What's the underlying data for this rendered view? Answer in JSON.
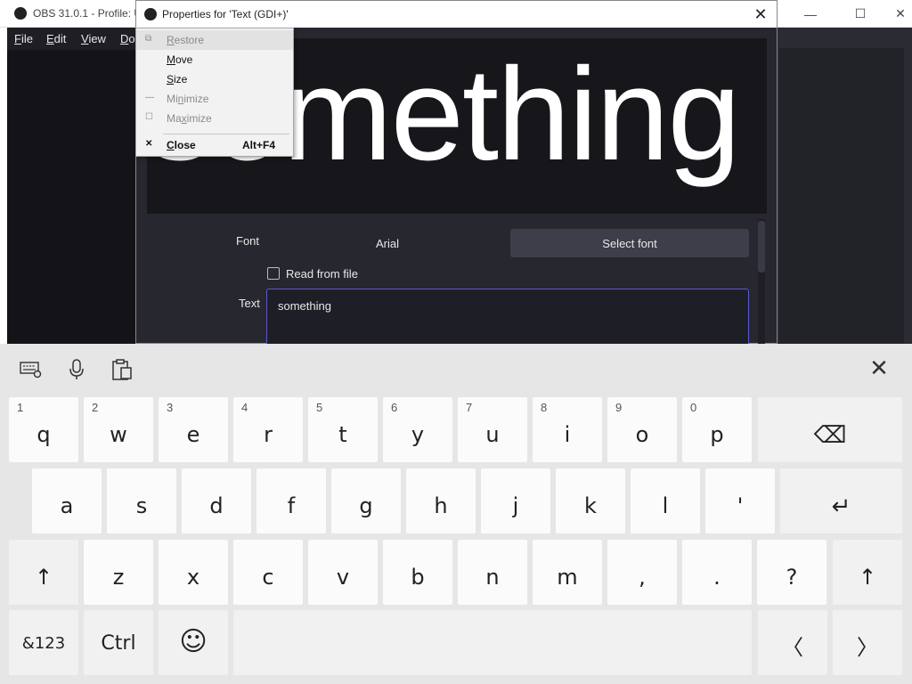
{
  "obs_window": {
    "title": "OBS 31.0.1 - Profile: U",
    "menu": [
      {
        "label": "File",
        "underline": "F",
        "rest": "ile"
      },
      {
        "label": "Edit",
        "underline": "E",
        "rest": "dit"
      },
      {
        "label": "View",
        "underline": "V",
        "rest": "iew"
      },
      {
        "label": "Do",
        "underline": "D",
        "rest": "o"
      }
    ],
    "minimize_glyph": "—",
    "maximize_glyph": "☐",
    "close_glyph": "✕"
  },
  "properties_dialog": {
    "title": "Properties for 'Text (GDI+)'",
    "close_glyph": "✕",
    "preview_text": "something",
    "font_label": "Font",
    "font_value": "Arial",
    "select_font_label": "Select font",
    "read_from_file_label": "Read from file",
    "read_from_file_checked": false,
    "text_label": "Text",
    "text_value": "something"
  },
  "system_menu": {
    "items": [
      {
        "label": "Restore",
        "u": "R",
        "rest": "estore",
        "icon": "restore-icon",
        "glyph": "⧉",
        "disabled": true
      },
      {
        "label": "Move",
        "u": "M",
        "rest": "ove",
        "icon": "",
        "glyph": "",
        "disabled": false
      },
      {
        "label": "Size",
        "u": "S",
        "rest": "ize",
        "icon": "",
        "glyph": "",
        "disabled": false
      },
      {
        "label": "Minimize",
        "u": "n",
        "pre": "Mi",
        "rest": "imize",
        "icon": "minimize-icon",
        "glyph": "—",
        "disabled": true
      },
      {
        "label": "Maximize",
        "u": "x",
        "pre": "Ma",
        "rest": "imize",
        "icon": "maximize-icon",
        "glyph": "☐",
        "disabled": true
      },
      {
        "label": "Close",
        "u": "C",
        "rest": "lose",
        "icon": "close-icon",
        "glyph": "✕",
        "disabled": false,
        "shortcut": "Alt+F4"
      }
    ]
  },
  "keyboard": {
    "toolbar": {
      "settings_icon": "keyboard-settings-icon",
      "mic_icon": "microphone-icon",
      "clipboard_icon": "clipboard-icon",
      "close_glyph": "✕"
    },
    "row1": [
      {
        "main": "q",
        "sub": "1"
      },
      {
        "main": "w",
        "sub": "2"
      },
      {
        "main": "e",
        "sub": "3"
      },
      {
        "main": "r",
        "sub": "4"
      },
      {
        "main": "t",
        "sub": "5"
      },
      {
        "main": "y",
        "sub": "6"
      },
      {
        "main": "u",
        "sub": "7"
      },
      {
        "main": "i",
        "sub": "8"
      },
      {
        "main": "o",
        "sub": "9"
      },
      {
        "main": "p",
        "sub": "0"
      }
    ],
    "backspace_glyph": "⌫",
    "row2": [
      "a",
      "s",
      "d",
      "f",
      "g",
      "h",
      "j",
      "k",
      "l",
      "'"
    ],
    "enter_glyph": "↵",
    "shift_glyph": "↑",
    "row3": [
      "z",
      "x",
      "c",
      "v",
      "b",
      "n",
      "m",
      ",",
      ".",
      "?"
    ],
    "symbols_label": "&123",
    "ctrl_label": "Ctrl",
    "emoji_glyph": "☺",
    "left_glyph": "〈",
    "right_glyph": "〉"
  }
}
